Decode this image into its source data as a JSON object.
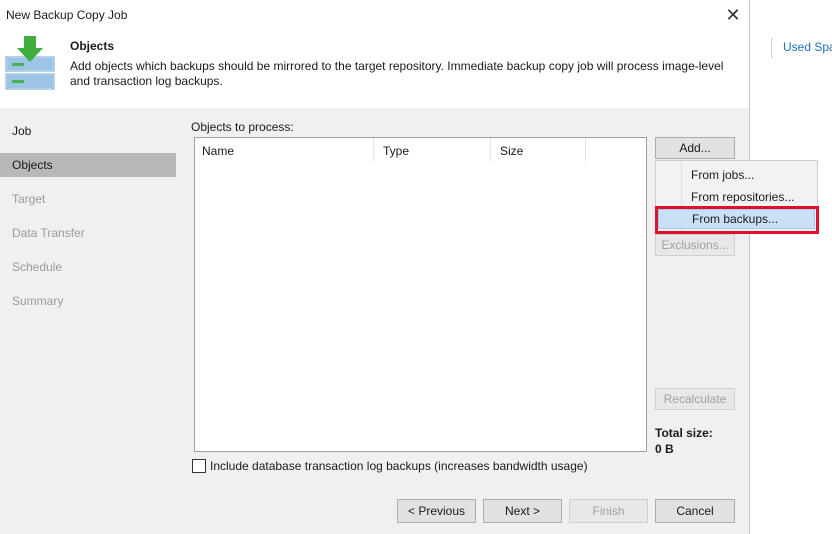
{
  "window": {
    "title": "New Backup Copy Job",
    "close_icon": "close-icon"
  },
  "background": {
    "used_space_label": "Used Spa"
  },
  "header": {
    "icon": "backup-copy-icon",
    "title": "Objects",
    "description": "Add objects which backups should be mirrored to the target repository. Immediate backup copy job will process image-level and transaction log backups."
  },
  "nav": {
    "items": [
      {
        "label": "Job",
        "state": "done"
      },
      {
        "label": "Objects",
        "state": "active"
      },
      {
        "label": "Target",
        "state": "pending"
      },
      {
        "label": "Data Transfer",
        "state": "pending"
      },
      {
        "label": "Schedule",
        "state": "pending"
      },
      {
        "label": "Summary",
        "state": "pending"
      }
    ]
  },
  "objects": {
    "label": "Objects to process:",
    "columns": [
      "Name",
      "Type",
      "Size"
    ],
    "rows": []
  },
  "buttons": {
    "add": "Add...",
    "exclusions": "Exclusions...",
    "recalculate": "Recalculate"
  },
  "add_menu": {
    "items": [
      {
        "label": "From jobs...",
        "highlighted": false
      },
      {
        "label": "From repositories...",
        "highlighted": false
      },
      {
        "label": "From backups...",
        "highlighted": true
      }
    ],
    "highlight_color": "#e0102a"
  },
  "totals": {
    "label": "Total size:",
    "value": "0 B"
  },
  "log_backup_option": {
    "label": "Include database transaction log backups (increases bandwidth usage)",
    "checked": false
  },
  "footer": {
    "previous": "< Previous",
    "next": "Next >",
    "finish": "Finish",
    "cancel": "Cancel"
  }
}
